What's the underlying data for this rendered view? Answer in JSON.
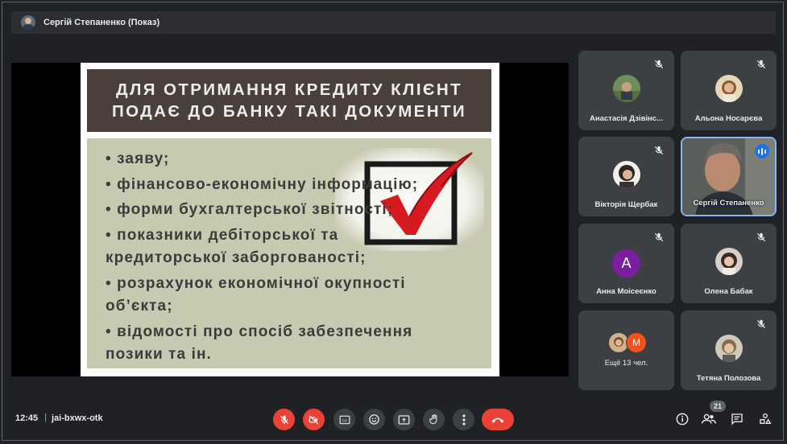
{
  "presenter": {
    "name": "Сергій Степаненко (Показ)"
  },
  "slide": {
    "title_line1": "ДЛЯ ОТРИМАННЯ КРЕДИТУ КЛІЄНТ",
    "title_line2": "ПОДАЄ ДО БАНКУ ТАКІ ДОКУМЕНТИ",
    "bullets": [
      {
        "l1": "• заяву;",
        "l2": ""
      },
      {
        "l1": "• фінансово-економічну інформацію;",
        "l2": ""
      },
      {
        "l1": "• форми бухгалтерської звітності;",
        "l2": ""
      },
      {
        "l1": "• показники дебіторської та",
        "l2": "кредиторської заборгованості;"
      },
      {
        "l1": "• розрахунок економічної окупності",
        "l2": "об’єкта;"
      },
      {
        "l1": "• відомості про спосіб забезпечення",
        "l2": "позики та ін."
      }
    ]
  },
  "participants": [
    {
      "name": "Анастасія Дзівінс...",
      "muted": true
    },
    {
      "name": "Альона Носарєва",
      "muted": true
    },
    {
      "name": "Вікторія Щербак",
      "muted": true
    },
    {
      "name": "Сергій Степаненко",
      "muted": false,
      "speaking": true
    },
    {
      "name": "Анна Моісеєнко",
      "muted": true,
      "initial": "A"
    },
    {
      "name": "Олена Бабак",
      "muted": true
    },
    {
      "name": "Ещё 13 чел.",
      "more_initial": "М"
    },
    {
      "name": "Тетяна Полозова",
      "muted": true
    }
  ],
  "bottom": {
    "time": "12:45",
    "separator": "|",
    "meeting_code": "jai-bxwx-otk",
    "participants_count": "21"
  },
  "colors": {
    "accent_red": "#ea4335",
    "speaking_blue": "#1a73e8",
    "slide_header": "#4a3f3b",
    "slide_body": "#c8c9b1"
  },
  "icons": {
    "mic": "mic-off-icon",
    "camera": "camera-off-icon",
    "captions": "captions-icon",
    "emoji": "emoji-icon",
    "present": "present-icon",
    "hand": "raise-hand-icon",
    "more": "more-vert-icon",
    "end": "end-call-icon",
    "info": "info-icon",
    "people": "people-icon",
    "chat": "chat-icon",
    "activities": "activities-icon"
  }
}
